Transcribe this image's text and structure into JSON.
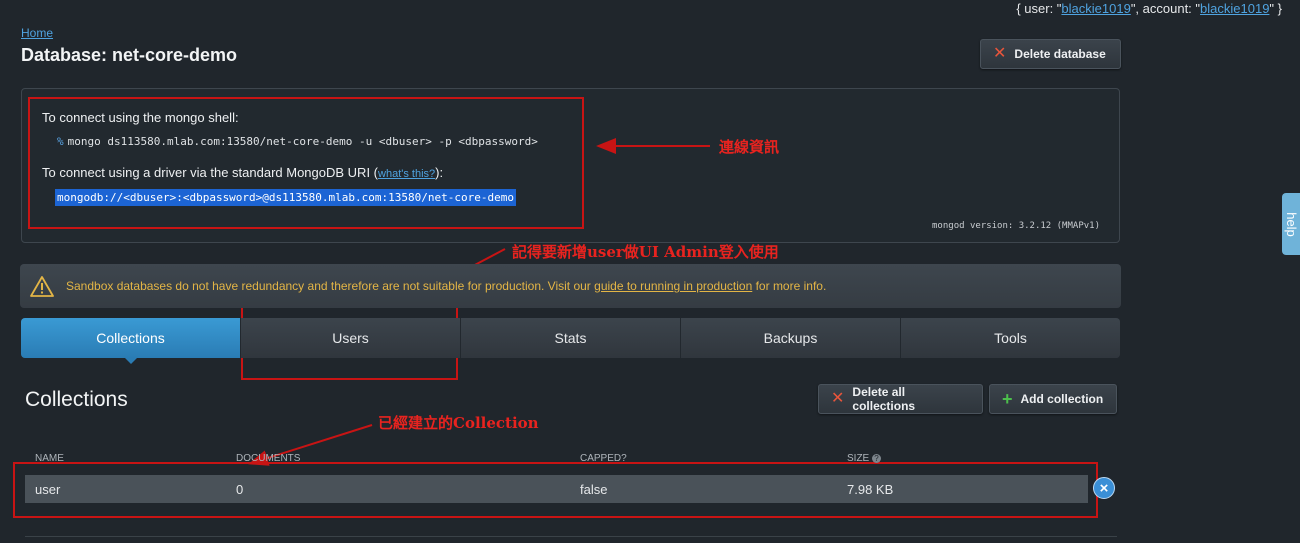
{
  "account_bar": {
    "prefix": "{ user: \"",
    "user": "blackie1019",
    "middle": "\", account: \"",
    "account": "blackie1019",
    "suffix": "\" }"
  },
  "breadcrumb": {
    "home": "Home"
  },
  "page_title": "Database: net-core-demo",
  "delete_database_label": "Delete database",
  "connection": {
    "shell_heading": "To connect using the mongo shell:",
    "shell_prompt": "%",
    "shell_command": "mongo ds113580.mlab.com:13580/net-core-demo -u <dbuser> -p <dbpassword>",
    "driver_heading_start": "To connect using a driver via the standard MongoDB URI (",
    "whats_this": "what's this?",
    "driver_heading_end": "):",
    "uri": "mongodb://<dbuser>:<dbpassword>@ds113580.mlab.com:13580/net-core-demo",
    "mongod_version": "mongod version: 3.2.12 (MMAPv1)"
  },
  "annotations": {
    "connection_info": "連線資訊",
    "users_note": "記得要新增user做UI Admin登入使用",
    "collection_note": "已經建立的Collection"
  },
  "warning": {
    "icon": "warning-triangle-icon",
    "text_before": "Sandbox databases do not have redundancy and therefore are not suitable for production. Visit our ",
    "link": "guide to running in production",
    "text_after": " for more info."
  },
  "tabs": [
    {
      "label": "Collections",
      "active": true
    },
    {
      "label": "Users",
      "active": false
    },
    {
      "label": "Stats",
      "active": false
    },
    {
      "label": "Backups",
      "active": false
    },
    {
      "label": "Tools",
      "active": false
    }
  ],
  "collections": {
    "title": "Collections",
    "delete_all_label": "Delete all collections",
    "add_label": "Add collection",
    "columns": [
      "NAME",
      "DOCUMENTS",
      "CAPPED?",
      "SIZE"
    ],
    "rows": [
      {
        "name": "user",
        "documents": "0",
        "capped": "false",
        "size": "7.98 KB"
      }
    ]
  },
  "help_tab": "help",
  "colors": {
    "background": "#20262c",
    "accent": "#2a7cb4",
    "warning": "#e3b546",
    "annotation": "#c81414"
  }
}
